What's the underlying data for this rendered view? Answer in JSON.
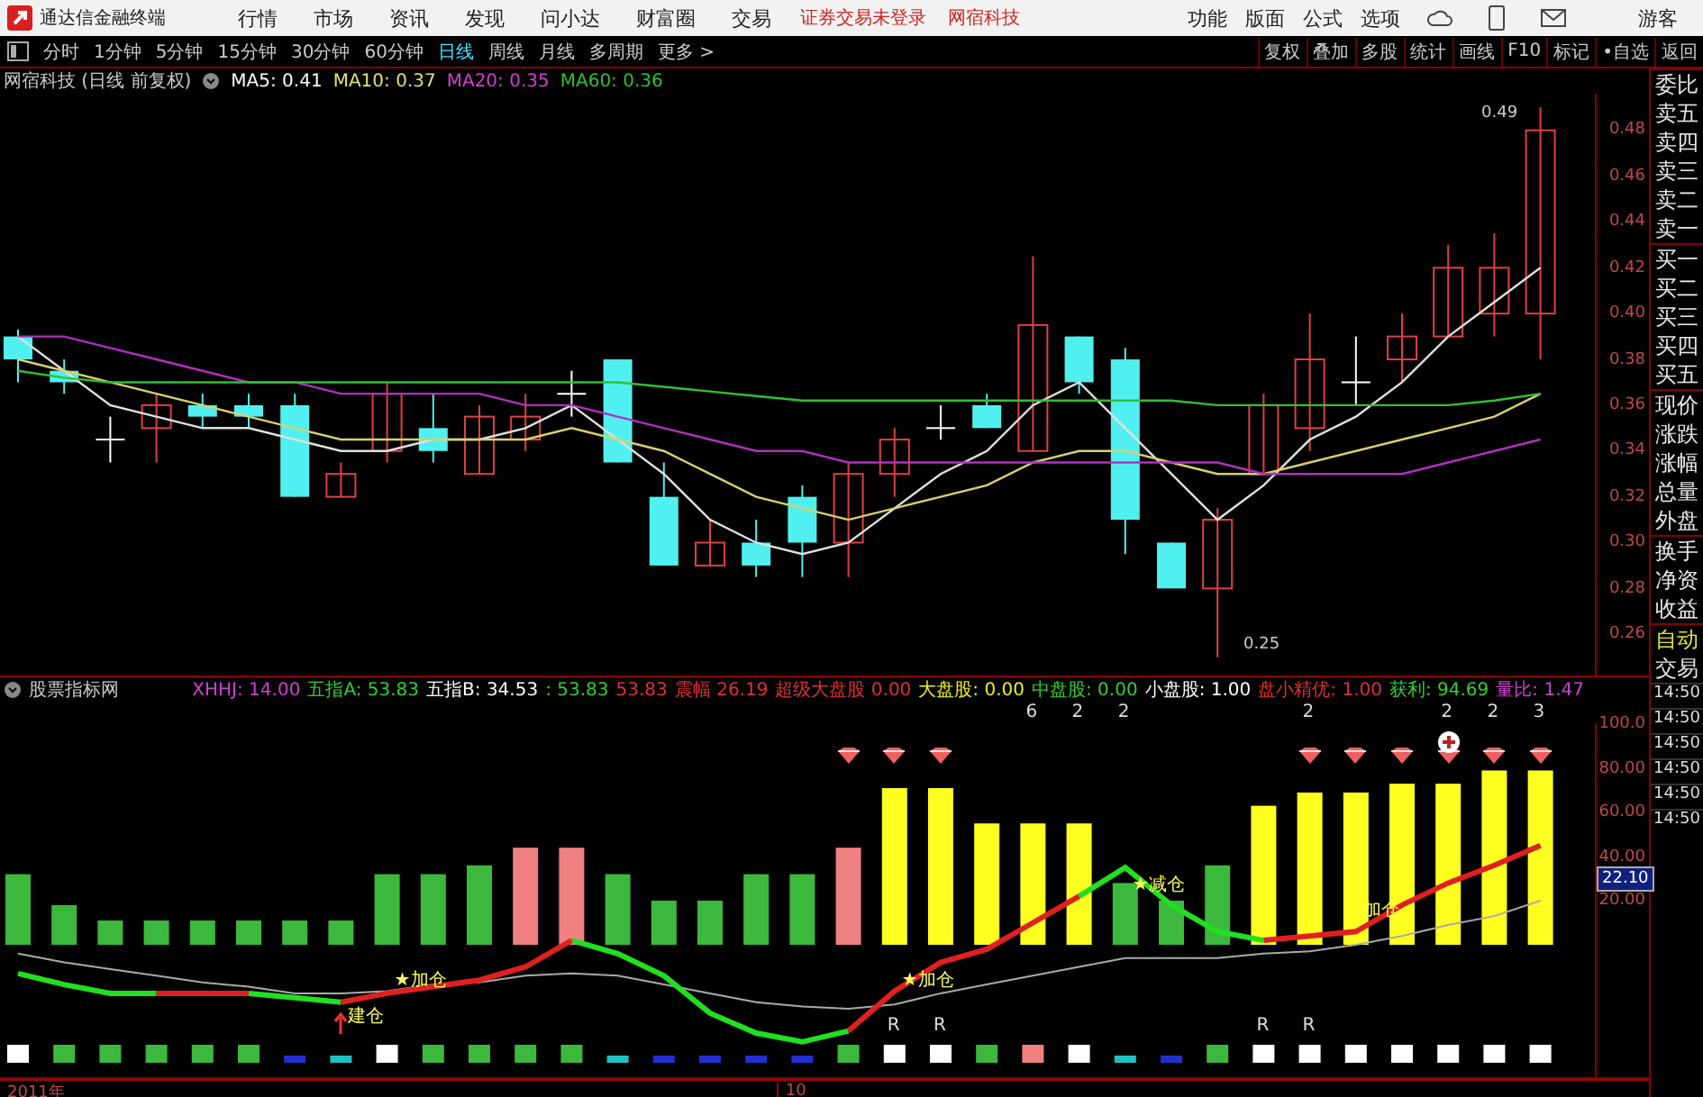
{
  "app": {
    "title": "通达信金融终端",
    "menus": [
      "行情",
      "市场",
      "资讯",
      "发现",
      "问小达",
      "财富圈",
      "交易"
    ],
    "notices": [
      "证券交易未登录",
      "网宿科技"
    ],
    "tools": [
      "功能",
      "版面",
      "公式",
      "选项"
    ],
    "user": "游客"
  },
  "periods": [
    {
      "label": "分时",
      "selected": false
    },
    {
      "label": "1分钟",
      "selected": false
    },
    {
      "label": "5分钟",
      "selected": false
    },
    {
      "label": "15分钟",
      "selected": false
    },
    {
      "label": "30分钟",
      "selected": false
    },
    {
      "label": "60分钟",
      "selected": false
    },
    {
      "label": "日线",
      "selected": true
    },
    {
      "label": "周线",
      "selected": false
    },
    {
      "label": "月线",
      "selected": false
    },
    {
      "label": "多周期",
      "selected": false
    },
    {
      "label": "更多 >",
      "selected": false
    }
  ],
  "actions": [
    "复权",
    "叠加",
    "多股",
    "统计",
    "画线",
    "F10",
    "标记",
    "•自选",
    "返回"
  ],
  "chart": {
    "title": "网宿科技 (日线 前复权)",
    "ma": [
      {
        "text": "MA5: 0.41",
        "color": "#ffffff"
      },
      {
        "text": "MA10: 0.37",
        "color": "#e8e070"
      },
      {
        "text": "MA20: 0.35",
        "color": "#d040d0"
      },
      {
        "text": "MA60: 0.36",
        "color": "#30c030"
      }
    ],
    "high_label": "0.49",
    "low_label": "0.25",
    "chart_data": {
      "type": "candlestick",
      "ohlc": [
        [
          0.39,
          0.393,
          0.37,
          0.38
        ],
        [
          0.375,
          0.38,
          0.365,
          0.37
        ],
        [
          0.345,
          0.355,
          0.335,
          0.345
        ],
        [
          0.35,
          0.365,
          0.335,
          0.36
        ],
        [
          0.36,
          0.365,
          0.35,
          0.355
        ],
        [
          0.36,
          0.365,
          0.35,
          0.355
        ],
        [
          0.36,
          0.365,
          0.32,
          0.32
        ],
        [
          0.32,
          0.335,
          0.32,
          0.33
        ],
        [
          0.34,
          0.37,
          0.335,
          0.365
        ],
        [
          0.35,
          0.365,
          0.335,
          0.34
        ],
        [
          0.33,
          0.36,
          0.33,
          0.355
        ],
        [
          0.345,
          0.365,
          0.34,
          0.355
        ],
        [
          0.365,
          0.375,
          0.355,
          0.365
        ],
        [
          0.38,
          0.38,
          0.335,
          0.335
        ],
        [
          0.32,
          0.335,
          0.29,
          0.29
        ],
        [
          0.29,
          0.31,
          0.29,
          0.3
        ],
        [
          0.3,
          0.31,
          0.285,
          0.29
        ],
        [
          0.32,
          0.325,
          0.285,
          0.3
        ],
        [
          0.3,
          0.335,
          0.285,
          0.33
        ],
        [
          0.33,
          0.35,
          0.32,
          0.345
        ],
        [
          0.35,
          0.36,
          0.345,
          0.35
        ],
        [
          0.36,
          0.365,
          0.35,
          0.35
        ],
        [
          0.34,
          0.425,
          0.34,
          0.395
        ],
        [
          0.39,
          0.39,
          0.365,
          0.37
        ],
        [
          0.38,
          0.385,
          0.295,
          0.31
        ],
        [
          0.3,
          0.3,
          0.28,
          0.28
        ],
        [
          0.28,
          0.315,
          0.25,
          0.31
        ],
        [
          0.33,
          0.365,
          0.33,
          0.36
        ],
        [
          0.35,
          0.4,
          0.34,
          0.38
        ],
        [
          0.37,
          0.39,
          0.36,
          0.37
        ],
        [
          0.38,
          0.4,
          0.37,
          0.39
        ],
        [
          0.39,
          0.43,
          0.39,
          0.42
        ],
        [
          0.4,
          0.435,
          0.39,
          0.42
        ],
        [
          0.4,
          0.49,
          0.38,
          0.48
        ]
      ],
      "series": [
        {
          "type": "line",
          "color": "#e0e0e0",
          "values": [
            0.39,
            0.375,
            0.36,
            0.355,
            0.35,
            0.35,
            0.345,
            0.34,
            0.34,
            0.345,
            0.345,
            0.35,
            0.36,
            0.345,
            0.33,
            0.31,
            0.3,
            0.295,
            0.3,
            0.315,
            0.33,
            0.34,
            0.36,
            0.37,
            0.35,
            0.33,
            0.31,
            0.325,
            0.345,
            0.355,
            0.37,
            0.39,
            0.405,
            0.42
          ]
        },
        {
          "type": "line",
          "color": "#d8d070",
          "values": [
            0.38,
            0.375,
            0.37,
            0.365,
            0.36,
            0.355,
            0.35,
            0.345,
            0.345,
            0.345,
            0.345,
            0.345,
            0.35,
            0.345,
            0.34,
            0.33,
            0.32,
            0.315,
            0.31,
            0.315,
            0.32,
            0.325,
            0.335,
            0.34,
            0.34,
            0.335,
            0.33,
            0.33,
            0.335,
            0.34,
            0.345,
            0.35,
            0.355,
            0.365
          ]
        },
        {
          "type": "line",
          "color": "#b030c0",
          "values": [
            0.39,
            0.39,
            0.385,
            0.38,
            0.375,
            0.37,
            0.37,
            0.365,
            0.365,
            0.365,
            0.365,
            0.36,
            0.36,
            0.355,
            0.35,
            0.345,
            0.34,
            0.34,
            0.335,
            0.335,
            0.335,
            0.335,
            0.335,
            0.335,
            0.335,
            0.335,
            0.335,
            0.33,
            0.33,
            0.33,
            0.33,
            0.335,
            0.34,
            0.345
          ]
        },
        {
          "type": "line",
          "color": "#30c030",
          "values": [
            0.375,
            0.372,
            0.37,
            0.37,
            0.37,
            0.37,
            0.37,
            0.37,
            0.37,
            0.37,
            0.37,
            0.37,
            0.37,
            0.37,
            0.368,
            0.366,
            0.364,
            0.362,
            0.362,
            0.362,
            0.362,
            0.362,
            0.362,
            0.362,
            0.362,
            0.362,
            0.36,
            0.36,
            0.36,
            0.36,
            0.36,
            0.36,
            0.362,
            0.365
          ]
        }
      ],
      "ylim": [
        0.242,
        0.496
      ],
      "yticks": [
        {
          "value": 0.48,
          "label": "0.48"
        },
        {
          "value": 0.46,
          "label": "0.46"
        },
        {
          "value": 0.44,
          "label": "0.44"
        },
        {
          "value": 0.42,
          "label": "0.42"
        },
        {
          "value": 0.4,
          "label": "0.40"
        },
        {
          "value": 0.38,
          "label": "0.38"
        },
        {
          "value": 0.36,
          "label": "0.36"
        },
        {
          "value": 0.34,
          "label": "0.34"
        },
        {
          "value": 0.32,
          "label": "0.32"
        },
        {
          "value": 0.3,
          "label": "0.30"
        },
        {
          "value": 0.28,
          "label": "0.28"
        },
        {
          "value": 0.26,
          "label": "0.26"
        }
      ]
    }
  },
  "indicator": {
    "title": "股票指标网",
    "values": [
      {
        "text": "XHHJ: 14.00",
        "color": "#d040d0"
      },
      {
        "text": "五指A: 53.83",
        "color": "#30d030"
      },
      {
        "text": "五指B: 34.53",
        "color": "#ffffff"
      },
      {
        "text": ": 53.83",
        "color": "#30d030"
      },
      {
        "text": "53.83",
        "color": "#e03030"
      },
      {
        "text": "震幅 26.19",
        "color": "#e03030"
      },
      {
        "text": "超级大盘股 0.00",
        "color": "#e03030"
      },
      {
        "text": "大盘股: 0.00",
        "color": "#f0f020"
      },
      {
        "text": "中盘股: 0.00",
        "color": "#30d030"
      },
      {
        "text": "小盘股: 1.00",
        "color": "#ffffff"
      },
      {
        "text": "盘小精优: 1.00",
        "color": "#e03030"
      },
      {
        "text": "获利: 94.69",
        "color": "#30d030"
      },
      {
        "text": "量比: 1.47",
        "color": "#d040d0"
      }
    ],
    "counts": [
      "6",
      "2",
      "2",
      "2",
      "2",
      "2",
      "3"
    ],
    "signals": [
      "建仓",
      "★加仓",
      "★加仓",
      "★减仓",
      "加仓"
    ],
    "r_marks": [
      "R",
      "R",
      "R",
      "R"
    ],
    "current": "22.10",
    "chart_data": {
      "type": "bar",
      "ylim": [
        -60,
        100
      ],
      "series": [
        {
          "type": "bar",
          "color": "#3cb83c",
          "values": [
            32,
            18,
            11,
            11,
            11,
            11,
            11,
            11,
            32,
            32,
            36,
            null,
            null,
            32,
            20,
            20,
            32,
            32,
            null,
            null,
            null,
            null,
            null,
            null,
            28,
            20,
            36,
            null,
            null,
            null,
            null,
            null,
            null,
            null
          ]
        },
        {
          "type": "bar",
          "color": "#f08080",
          "values": [
            null,
            null,
            null,
            null,
            null,
            null,
            null,
            null,
            null,
            null,
            null,
            44,
            44,
            null,
            null,
            null,
            null,
            null,
            44,
            null,
            null,
            null,
            null,
            null,
            null,
            null,
            null,
            null,
            null,
            null,
            null,
            null,
            null,
            null
          ]
        },
        {
          "type": "bar",
          "color": "#ffff20",
          "values": [
            null,
            null,
            null,
            null,
            null,
            null,
            null,
            null,
            null,
            null,
            null,
            null,
            null,
            null,
            null,
            null,
            null,
            null,
            null,
            71,
            71,
            55,
            55,
            55,
            null,
            null,
            null,
            63,
            69,
            69,
            73,
            73,
            79,
            79
          ]
        },
        {
          "type": "line",
          "color": "#aaaaaa",
          "values": [
            -4,
            -8,
            -11,
            -14,
            -17,
            -19,
            -22,
            -22,
            -21,
            -18,
            -17,
            -14,
            -13,
            -14,
            -18,
            -22,
            -26,
            -28,
            -29,
            -27,
            -22,
            -18,
            -14,
            -10,
            -6,
            -6,
            -6,
            -4,
            -3,
            0,
            4,
            9,
            13,
            20
          ]
        },
        {
          "type": "line",
          "color": "#20e020",
          "values": [
            -13,
            -18,
            -22,
            -22,
            null,
            -22,
            -24,
            -26,
            null,
            null,
            null,
            null,
            2,
            -4,
            -14,
            -31,
            -40,
            -44,
            -39,
            null,
            null,
            null,
            null,
            22,
            35,
            18,
            6,
            2,
            null,
            null,
            null,
            null,
            null,
            null
          ]
        },
        {
          "type": "line",
          "color": "#e02020",
          "values": [
            null,
            null,
            null,
            -22,
            -22,
            -22,
            null,
            -26,
            -22,
            -19,
            -16,
            -10,
            2,
            null,
            null,
            null,
            null,
            null,
            -39,
            -21,
            -8,
            -2,
            10,
            22,
            null,
            null,
            null,
            2,
            4,
            6,
            18,
            28,
            36,
            45
          ]
        }
      ],
      "yticks": [
        {
          "value": 100,
          "label": "100.0"
        },
        {
          "value": 80,
          "label": "80.00"
        },
        {
          "value": 60,
          "label": "60.00"
        },
        {
          "value": 40,
          "label": "40.00"
        },
        {
          "value": 20,
          "label": "20.00"
        }
      ]
    }
  },
  "dates": [
    "2011年",
    "10"
  ],
  "side": [
    "委比",
    "卖五",
    "卖四",
    "卖三",
    "卖二",
    "卖一",
    "买一",
    "买二",
    "买三",
    "买四",
    "买五",
    "现价",
    "涨跌",
    "涨幅",
    "总量",
    "外盘",
    "换手",
    "净资",
    "收益",
    "自动",
    "交易"
  ],
  "times": [
    "14:50",
    "14:50",
    "14:50",
    "14:50",
    "14:50",
    "14:50"
  ]
}
